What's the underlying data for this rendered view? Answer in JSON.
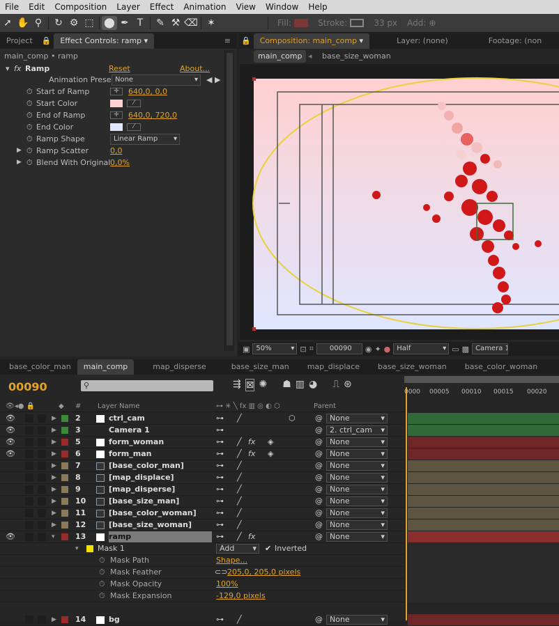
{
  "menu": [
    "File",
    "Edit",
    "Composition",
    "Layer",
    "Effect",
    "Animation",
    "View",
    "Window",
    "Help"
  ],
  "toolbar": {
    "fill_label": "Fill:",
    "stroke_label": "Stroke:",
    "stroke_width": "33 px",
    "add_label": "Add:"
  },
  "effect_panel": {
    "tab_project": "Project",
    "tab_effect": "Effect Controls: ramp",
    "breadcrumb": "main_comp • ramp",
    "effect_name": "Ramp",
    "reset": "Reset",
    "about": "About...",
    "presets_label": "Animation Presets:",
    "presets_value": "None",
    "props": [
      {
        "label": "Start of Ramp",
        "value": "640,0, 0,0"
      },
      {
        "label": "Start Color",
        "value": ""
      },
      {
        "label": "End of Ramp",
        "value": "640,0, 720,0"
      },
      {
        "label": "End Color",
        "value": ""
      },
      {
        "label": "Ramp Shape",
        "value": "Linear Ramp"
      },
      {
        "label": "Ramp Scatter",
        "value": "0,0"
      },
      {
        "label": "Blend With Original",
        "value": "0,0%"
      }
    ]
  },
  "viewer": {
    "tab_comp": "Composition: main_comp",
    "tab_layer": "Layer: (none)",
    "tab_footage": "Footage: (non",
    "crumb1": "main_comp",
    "crumb2": "base_size_woman",
    "zoom": "50%",
    "timecode": "00090",
    "resolution": "Half",
    "camera": "Camera 1"
  },
  "timeline": {
    "tabs": [
      "base_color_man",
      "main_comp",
      "map_disperse",
      "base_size_man",
      "map_displace",
      "base_size_woman",
      "base_color_woman"
    ],
    "timecode": "00090",
    "col_layer_name": "Layer Name",
    "col_parent": "Parent",
    "ruler": [
      "0000",
      "00005",
      "00010",
      "00015",
      "00020"
    ],
    "layers": [
      {
        "num": "2",
        "name": "ctrl_cam",
        "color": "#3a8a3a",
        "parent": "None",
        "fx": ""
      },
      {
        "num": "3",
        "name": "Camera 1",
        "color": "#3a8a3a",
        "parent": "2. ctrl_cam",
        "fx": ""
      },
      {
        "num": "5",
        "name": "form_woman",
        "color": "#9a2a2a",
        "parent": "None",
        "fx": "fx"
      },
      {
        "num": "6",
        "name": "form_man",
        "color": "#9a2a2a",
        "parent": "None",
        "fx": "fx"
      },
      {
        "num": "7",
        "name": "[base_color_man]",
        "color": "#8a7a5a",
        "parent": "None",
        "fx": ""
      },
      {
        "num": "8",
        "name": "[map_displace]",
        "color": "#8a7a5a",
        "parent": "None",
        "fx": ""
      },
      {
        "num": "9",
        "name": "[map_disperse]",
        "color": "#8a7a5a",
        "parent": "None",
        "fx": ""
      },
      {
        "num": "10",
        "name": "[base_size_man]",
        "color": "#8a7a5a",
        "parent": "None",
        "fx": ""
      },
      {
        "num": "11",
        "name": "[base_color_woman]",
        "color": "#8a7a5a",
        "parent": "None",
        "fx": ""
      },
      {
        "num": "12",
        "name": "[base_size_woman]",
        "color": "#8a7a5a",
        "parent": "None",
        "fx": ""
      },
      {
        "num": "13",
        "name": "ramp",
        "color": "#9a2a2a",
        "parent": "None",
        "fx": "fx"
      }
    ],
    "mask": {
      "name": "Mask 1",
      "mode": "Add",
      "inverted": "Inverted",
      "props": [
        {
          "label": "Mask Path",
          "value": "Shape..."
        },
        {
          "label": "Mask Feather",
          "value": "205,0, 205,0 pixels"
        },
        {
          "label": "Mask Opacity",
          "value": "100%"
        },
        {
          "label": "Mask Expansion",
          "value": "-129,0 pixels"
        }
      ]
    },
    "last_layer": {
      "num": "14",
      "name": "bg",
      "color": "#9a2a2a",
      "parent": "None"
    }
  }
}
